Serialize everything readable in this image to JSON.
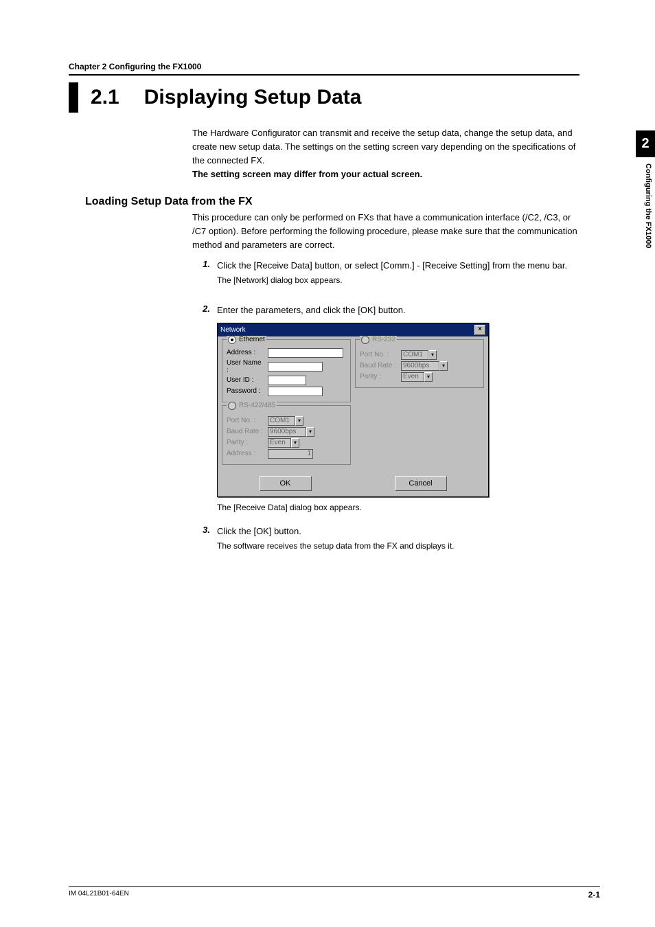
{
  "header": {
    "chapter_line": "Chapter 2    Configuring the FX1000",
    "section_number": "2.1",
    "section_title": "Displaying Setup Data"
  },
  "side_tab": {
    "number": "2",
    "label": "Configuring the FX1000"
  },
  "intro": {
    "p1": "The Hardware Configurator can transmit and receive the setup data, change the setup data, and create new setup data.  The settings on the setting screen vary depending on the specifications of the connected FX.",
    "p2": "The setting screen may differ from your actual screen."
  },
  "loading": {
    "heading": "Loading Setup Data from the FX",
    "p1": "This procedure can only be performed on FXs that have a communication interface (/C2, /C3, or /C7 option). Before performing the following procedure, please make sure that the communication method and parameters are correct.",
    "steps": {
      "s1": {
        "n": "1.",
        "text": "Click the [Receive Data] button, or select [Comm.] - [Receive Setting] from the menu bar.",
        "note": "The [Network] dialog box appears."
      },
      "s2": {
        "n": "2.",
        "text": "Enter the parameters, and click the [OK] button."
      },
      "s3": {
        "n": "3.",
        "text": "Click the [OK] button.",
        "note": "The software receives the setup data from the FX and displays it."
      }
    },
    "after_dialog_note": "The [Receive Data] dialog box appears."
  },
  "dialog": {
    "title": "Network",
    "ethernet": {
      "legend": "Ethernet",
      "address_lbl": "Address :",
      "username_lbl": "User Name :",
      "userid_lbl": "User ID :",
      "password_lbl": "Password :"
    },
    "rs422": {
      "legend": "RS-422/485",
      "port_lbl": "Port No. :",
      "port_val": "COM1",
      "baud_lbl": "Baud Rate :",
      "baud_val": "9600bps",
      "parity_lbl": "Parity :",
      "parity_val": "Even",
      "address_lbl": "Address :",
      "address_val": "1"
    },
    "rs232": {
      "legend": "RS-232",
      "port_lbl": "Port No. :",
      "port_val": "COM1",
      "baud_lbl": "Baud Rate :",
      "baud_val": "9600bps",
      "parity_lbl": "Parity :",
      "parity_val": "Even"
    },
    "ok": "OK",
    "cancel": "Cancel"
  },
  "footer": {
    "doc": "IM 04L21B01-64EN",
    "page": "2-1"
  }
}
